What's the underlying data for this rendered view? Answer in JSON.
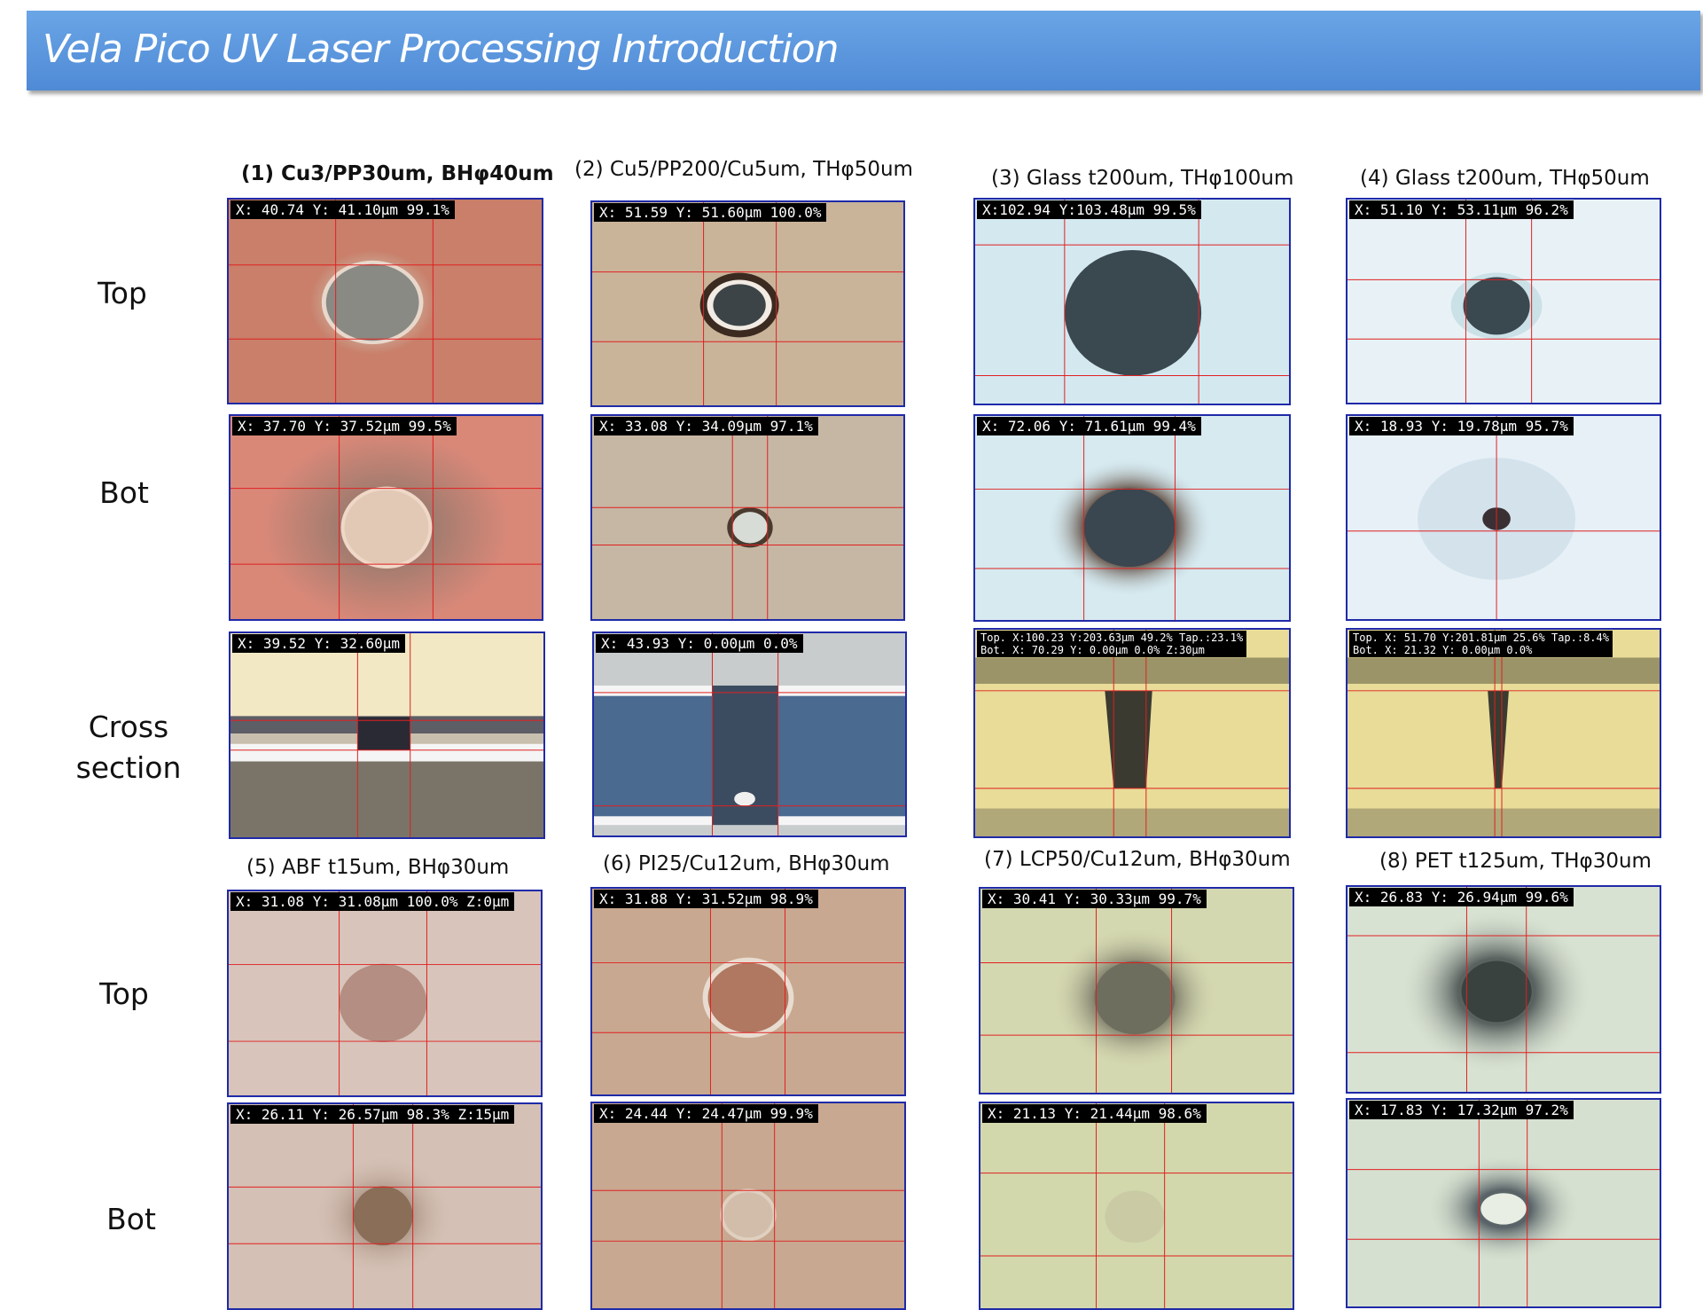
{
  "title": "Vela  Pico UV Laser  Processing Introduction",
  "row_labels": {
    "top": "Top",
    "bot": "Bot",
    "cross_line1": "Cross",
    "cross_line2": "section",
    "top2": "Top",
    "bot2": "Bot"
  },
  "samples": [
    {
      "title": "(1) Cu3/PP30um, BHφ40um",
      "top": "X: 40.74  Y: 41.10μm  99.1%",
      "bot": "X: 37.70  Y: 37.52μm  99.5%",
      "cross": "X: 39.52  Y: 32.60μm"
    },
    {
      "title": "(2) Cu5/PP200/Cu5um, THφ50um",
      "top": "X: 51.59  Y: 51.60μm  100.0%",
      "bot": "X: 33.08  Y: 34.09μm  97.1%",
      "cross": "X: 43.93  Y:  0.00μm  0.0%"
    },
    {
      "title": "(3) Glass t200um, THφ100um",
      "top": "X:102.94  Y:103.48μm  99.5%",
      "bot": "X: 72.06  Y: 71.61μm  99.4%",
      "cross_l1": "Top. X:100.23  Y:203.63μm  49.2%  Tap.:23.1%",
      "cross_l2": "Bot. X: 70.29  Y:  0.00μm   0.0%  Z:30μm"
    },
    {
      "title": "(4) Glass t200um, THφ50um",
      "top": "X: 51.10  Y: 53.11μm  96.2%",
      "bot": "X: 18.93  Y: 19.78μm  95.7%",
      "cross_l1": "Top. X: 51.70  Y:201.81μm  25.6%  Tap.:8.4%",
      "cross_l2": "Bot. X: 21.32  Y:  0.00μm   0.0%"
    },
    {
      "title": "(5) ABF t15um, BHφ30um",
      "top": "X: 31.08  Y: 31.08μm  100.0%  Z:0μm",
      "bot": "X: 26.11  Y: 26.57μm  98.3%  Z:15μm"
    },
    {
      "title": "(6) PI25/Cu12um, BHφ30um",
      "top": "X: 31.88  Y: 31.52μm  98.9%",
      "bot": "X: 24.44  Y: 24.47μm  99.9%"
    },
    {
      "title": "(7) LCP50/Cu12um, BHφ30um",
      "top": "X: 30.41  Y: 30.33μm  99.7%",
      "bot": "X: 21.13  Y: 21.44μm  98.6%"
    },
    {
      "title": "(8) PET t125um, THφ30um",
      "top": "X: 26.83  Y: 26.94μm  99.6%",
      "bot": "X: 17.83  Y: 17.32μm  97.2%"
    }
  ]
}
